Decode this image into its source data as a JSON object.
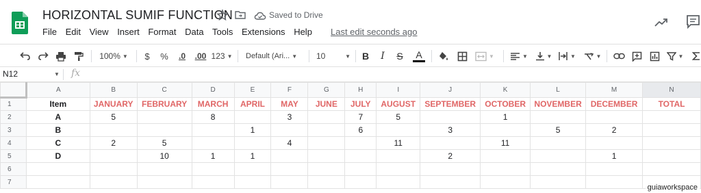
{
  "doc": {
    "title": "HORIZONTAL SUMIF FUNCTION",
    "saved_status": "Saved to Drive",
    "last_edit": "Last edit seconds ago"
  },
  "menu": [
    "File",
    "Edit",
    "View",
    "Insert",
    "Format",
    "Data",
    "Tools",
    "Extensions",
    "Help"
  ],
  "toolbar": {
    "zoom": "100%",
    "currency": "$",
    "percent": "%",
    "decrease_decimal": ".0",
    "increase_decimal": ".00",
    "more_formats": "123",
    "font": "Default (Ari...",
    "font_size": "10",
    "bold": "B",
    "italic": "I",
    "strike": "S",
    "text_color": "A"
  },
  "formula_bar": {
    "cell_ref": "N12",
    "fx": "fx"
  },
  "sheet": {
    "columns": [
      "A",
      "B",
      "C",
      "D",
      "E",
      "F",
      "G",
      "H",
      "I",
      "J",
      "K",
      "L",
      "M",
      "N"
    ],
    "rows": [
      [
        "1",
        "Item",
        "JANUARY",
        "FEBRUARY",
        "MARCH",
        "APRIL",
        "MAY",
        "JUNE",
        "JULY",
        "AUGUST",
        "SEPTEMBER",
        "OCTOBER",
        "NOVEMBER",
        "DECEMBER",
        "TOTAL"
      ],
      [
        "2",
        "A",
        "5",
        "",
        "8",
        "",
        "3",
        "",
        "7",
        "5",
        "",
        "1",
        "",
        "",
        ""
      ],
      [
        "3",
        "B",
        "",
        "",
        "",
        "1",
        "",
        "",
        "6",
        "",
        "3",
        "",
        "5",
        "2",
        ""
      ],
      [
        "4",
        "C",
        "2",
        "5",
        "",
        "",
        "4",
        "",
        "",
        "11",
        "",
        "11",
        "",
        "",
        ""
      ],
      [
        "5",
        "D",
        "",
        "10",
        "1",
        "1",
        "",
        "",
        "",
        "",
        "2",
        "",
        "",
        "1",
        ""
      ],
      [
        "6",
        "",
        "",
        "",
        "",
        "",
        "",
        "",
        "",
        "",
        "",
        "",
        "",
        "",
        ""
      ],
      [
        "7",
        "",
        "",
        "",
        "",
        "",
        "",
        "",
        "",
        "",
        "",
        "",
        "",
        "",
        ""
      ]
    ]
  },
  "watermark": "guiaworkspace",
  "colors": {
    "header_text": "#e06666",
    "sheets_green": "#0f9d58"
  }
}
